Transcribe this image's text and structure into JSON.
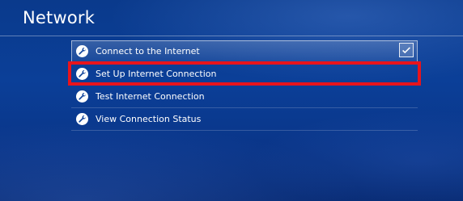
{
  "header": {
    "title": "Network"
  },
  "menu": {
    "items": [
      {
        "label": "Connect to the Internet",
        "icon": "wrench-icon",
        "checked": true
      },
      {
        "label": "Set Up Internet Connection",
        "icon": "wrench-icon"
      },
      {
        "label": "Test Internet Connection",
        "icon": "wrench-icon"
      },
      {
        "label": "View Connection Status",
        "icon": "wrench-icon"
      }
    ]
  },
  "colors": {
    "background": "#0b3f98",
    "highlight_border": "#e8141c",
    "text": "#ffffff"
  }
}
